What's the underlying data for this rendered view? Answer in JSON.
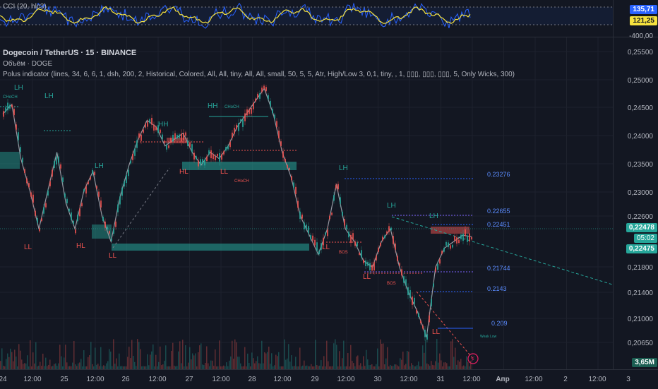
{
  "cci": {
    "label": "CCI (20, hlc3)",
    "value1": "135,71",
    "value2": "121,25",
    "scale_low": "-400,00"
  },
  "legend": {
    "symbol": "Dogecoin / TetherUS · 15 · BINANCE",
    "volume": "Объём · DOGE",
    "indicator": "Polus indicator (lines, 34, 6, 6, 1, dsh, 200, 2, Historical, Colored, All, All, tiny, All, All, small, 50, 5, 5, Atr, High/Low 3, 0,1, tiny, , 1, ▯▯▯, ▯▯▯, ▯▯▯, 5, Only Wicks, 300)"
  },
  "price_axis": [
    "0,25500",
    "0,25000",
    "0,24500",
    "0,24000",
    "0,23500",
    "0,23000",
    "0,22600",
    "0,21800",
    "0,21400",
    "0,21000",
    "0,20650"
  ],
  "price_badges": {
    "current": "0,22478",
    "countdown": "05:02",
    "second": "0,22475",
    "volume": "3,65M"
  },
  "time_axis": [
    "24",
    "12:00",
    "25",
    "12:00",
    "26",
    "12:00",
    "27",
    "12:00",
    "28",
    "12:00",
    "29",
    "12:00",
    "30",
    "12:00",
    "31",
    "12:00",
    "Апр",
    "12:00",
    "2",
    "12:00",
    "3"
  ],
  "level_labels": {
    "l1": "0.23276",
    "l2": "0.22655",
    "l3": "0.22451",
    "l4": "0.21744",
    "l5": "0.2143",
    "l6": "0.209"
  },
  "structure_labels": {
    "lh1": "LH",
    "lh2": "LH",
    "lh3": "LH",
    "lh4": "LH",
    "lh5": "LH",
    "lh6": "LH",
    "hh1": "HH",
    "hh2": "HH",
    "ll1": "LL",
    "ll2": "LL",
    "ll3": "LL",
    "ll4": "LL",
    "ll5": "LL",
    "ll6": "LL",
    "hl1": "HL",
    "hl2": "HL",
    "choch1": "CHoCH",
    "choch2": "CHoCH",
    "choch3": "CHoCH",
    "bos1": "BOS",
    "bos2": "BOS",
    "weak_low": "Weak Low"
  },
  "colors": {
    "bg": "#131722",
    "bull": "#26a69a",
    "bear": "#ef5350",
    "level": "#2962ff",
    "cci": "#f7e33e",
    "cci_band": "#2962ff"
  },
  "chart_data": {
    "type": "line",
    "series": [
      {
        "values": [
          0.244,
          0.2455,
          0.237,
          0.232,
          0.226,
          0.232,
          0.238,
          0.23,
          0.226,
          0.232,
          0.235,
          0.228,
          0.224,
          0.231,
          0.236,
          0.24,
          0.243,
          0.242,
          0.239,
          0.24,
          0.241,
          0.238,
          0.236,
          0.238,
          0.237,
          0.239,
          0.242,
          0.244,
          0.246,
          0.248,
          0.244,
          0.238,
          0.234,
          0.228,
          0.225,
          0.222,
          0.226,
          0.233,
          0.226,
          0.224,
          0.221,
          0.22,
          0.224,
          0.226,
          0.22,
          0.216,
          0.213,
          0.209,
          0.22,
          0.223,
          0.224,
          0.225,
          0.22478
        ]
      }
    ],
    "ylim": [
      0.204,
      0.256
    ]
  }
}
